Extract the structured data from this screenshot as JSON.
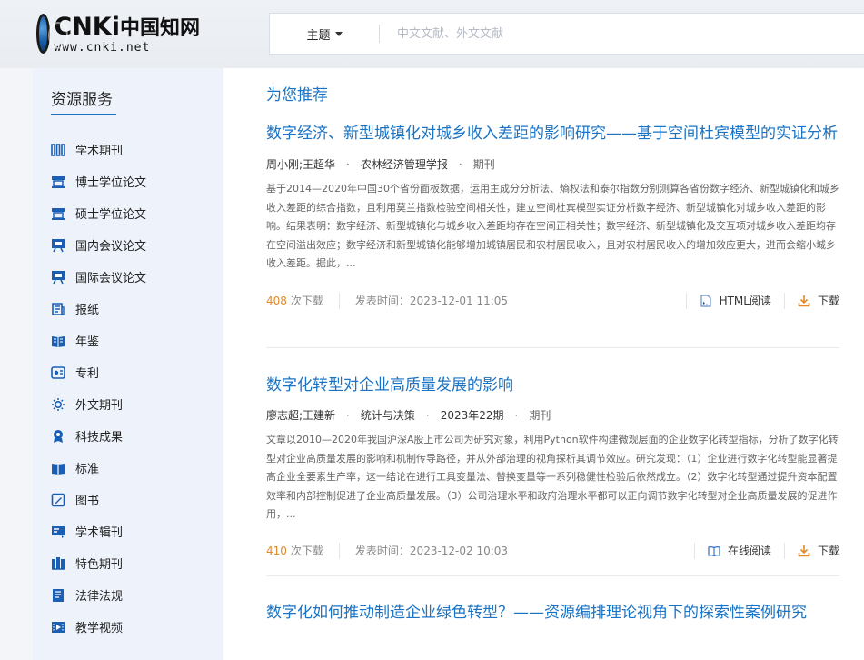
{
  "logo": {
    "main": "CNKi",
    "cn": "中国知网",
    "sub": "www.cnki.net"
  },
  "search": {
    "type": "主题",
    "placeholder": "中文文献、外文文献"
  },
  "sidebar": {
    "title": "资源服务",
    "items": [
      {
        "label": "学术期刊",
        "icon": "journal-icon"
      },
      {
        "label": "博士学位论文",
        "icon": "doctor-thesis-icon"
      },
      {
        "label": "硕士学位论文",
        "icon": "master-thesis-icon"
      },
      {
        "label": "国内会议论文",
        "icon": "domestic-conference-icon"
      },
      {
        "label": "国际会议论文",
        "icon": "international-conference-icon"
      },
      {
        "label": "报纸",
        "icon": "newspaper-icon"
      },
      {
        "label": "年鉴",
        "icon": "yearbook-icon"
      },
      {
        "label": "专利",
        "icon": "patent-icon"
      },
      {
        "label": "外文期刊",
        "icon": "foreign-journal-icon"
      },
      {
        "label": "科技成果",
        "icon": "achievement-icon"
      },
      {
        "label": "标准",
        "icon": "standard-icon"
      },
      {
        "label": "图书",
        "icon": "book-icon"
      },
      {
        "label": "学术辑刊",
        "icon": "collection-icon"
      },
      {
        "label": "特色期刊",
        "icon": "featured-journal-icon"
      },
      {
        "label": "法律法规",
        "icon": "law-icon"
      },
      {
        "label": "教学视频",
        "icon": "video-icon"
      }
    ]
  },
  "main": {
    "section_title": "为您推荐",
    "articles": [
      {
        "title": "数字经济、新型城镇化对城乡收入差距的影响研究——基于空间杜宾模型的实证分析",
        "authors": "周小刚;王超华",
        "source": "农林经济管理学报",
        "issue": "",
        "type": "期刊",
        "abstract": "基于2014—2020年中国30个省份面板数据，运用主成分分析法、熵权法和泰尔指数分别测算各省份数字经济、新型城镇化和城乡收入差距的综合指数，且利用莫兰指数检验空间相关性，建立空间杜宾模型实证分析数字经济、新型城镇化对城乡收入差距的影响。结果表明：数字经济、新型城镇化与城乡收入差距均存在空间正相关性；数字经济、新型城镇化及交互项对城乡收入差距均存在空间溢出效应；数字经济和新型城镇化能够增加城镇居民和农村居民收入，且对农村居民收入的增加效应更大，进而会缩小城乡收入差距。据此，...",
        "downloads": "408",
        "downloads_label": "次下载",
        "pubtime": "发表时间：2023-12-01 11:05",
        "read_label": "HTML阅读",
        "download_label": "下载"
      },
      {
        "title": "数字化转型对企业高质量发展的影响",
        "authors": "廖志超;王建新",
        "source": "统计与决策",
        "issue": "2023年22期",
        "type": "期刊",
        "abstract": "文章以2010—2020年我国沪深A股上市公司为研究对象，利用Python软件构建微观层面的企业数字化转型指标，分析了数字化转型对企业高质量发展的影响和机制传导路径，并从外部治理的视角探析其调节效应。研究发现：（1）企业进行数字化转型能显著提高企业全要素生产率，这一结论在进行工具变量法、替换变量等一系列稳健性检验后依然成立。（2）数字化转型通过提升资本配置效率和内部控制促进了企业高质量发展。（3）公司治理水平和政府治理水平都可以正向调节数字化转型对企业高质量发展的促进作用，...",
        "downloads": "410",
        "downloads_label": "次下载",
        "pubtime": "发表时间：2023-12-02 10:03",
        "read_label": "在线阅读",
        "download_label": "下载"
      },
      {
        "title": "数字化如何推动制造企业绿色转型？——资源编排理论视角下的探索性案例研究"
      }
    ]
  },
  "colors": {
    "link": "#1a73c4",
    "accent_download": "#e08a2a",
    "sidebar_bg": "#eef3fb",
    "icon": "#1a5fb4"
  }
}
